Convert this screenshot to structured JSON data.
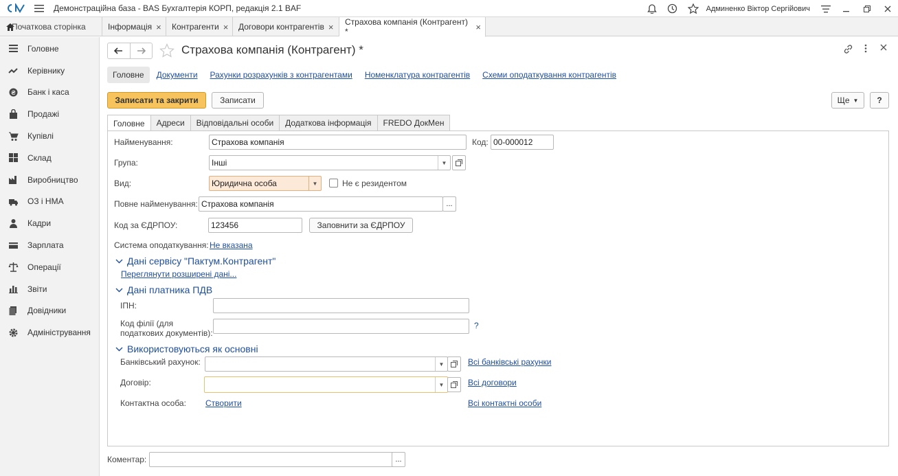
{
  "app": {
    "title": "Демонстраційна база - BAS Бухгалтерія КОРП, редакція 2.1 BAF",
    "user": "Админенко Віктор Сергійович"
  },
  "tabs": {
    "home": "Початкова сторінка",
    "items": [
      {
        "label": "Інформація"
      },
      {
        "label": "Контрагенти"
      },
      {
        "label": "Договори контрагентів"
      },
      {
        "label": "Страхова компанія (Контрагент) *"
      }
    ]
  },
  "sidebar": {
    "items": [
      {
        "label": "Головне",
        "icon": "menu-lines-icon"
      },
      {
        "label": "Керівнику",
        "icon": "trend-icon"
      },
      {
        "label": "Банк і каса",
        "icon": "coin-icon"
      },
      {
        "label": "Продажі",
        "icon": "bag-icon"
      },
      {
        "label": "Купівлі",
        "icon": "cart-icon"
      },
      {
        "label": "Склад",
        "icon": "grid-icon"
      },
      {
        "label": "Виробництво",
        "icon": "factory-icon"
      },
      {
        "label": "ОЗ і НМА",
        "icon": "truck-icon"
      },
      {
        "label": "Кадри",
        "icon": "person-icon"
      },
      {
        "label": "Зарплата",
        "icon": "card-icon"
      },
      {
        "label": "Операції",
        "icon": "scale-icon"
      },
      {
        "label": "Звіти",
        "icon": "bar-chart-icon"
      },
      {
        "label": "Довідники",
        "icon": "books-icon"
      },
      {
        "label": "Адміністрування",
        "icon": "gear-icon"
      }
    ]
  },
  "form": {
    "title": "Страхова компанія (Контрагент) *",
    "nav_links": {
      "main": "Головне",
      "documents": "Документи",
      "accounts": "Рахунки розрахунків з контрагентами",
      "nomenclature": "Номенклатура контрагентів",
      "tax_schemes": "Схеми оподаткування контрагентів"
    },
    "buttons": {
      "save_close": "Записати та закрити",
      "save": "Записати",
      "more": "Ще",
      "help": "?"
    },
    "tabs": [
      "Головне",
      "Адреси",
      "Відповідальні особи",
      "Додаткова інформація",
      "FREDO ДокМен"
    ],
    "fields": {
      "name_label": "Найменування:",
      "name_value": "Страхова компанія",
      "code_label": "Код:",
      "code_value": "00-000012",
      "group_label": "Група:",
      "group_value": "Інші",
      "kind_label": "Вид:",
      "kind_value": "Юридична особа",
      "nonresident_label": "Не є резидентом",
      "full_name_label": "Повне найменування:",
      "full_name_value": "Страхова компанія",
      "edrpou_label": "Код за ЄДРПОУ:",
      "edrpou_value": "123456",
      "fill_edrpou": "Заповнити за ЄДРПОУ",
      "tax_system_label": "Система оподаткування:",
      "tax_system_value": "Не вказана"
    },
    "sections": {
      "paktum_title": "Дані сервісу \"Пактум.Контрагент\"",
      "paktum_link": "Переглянути розширені дані...",
      "vat_title": "Дані платника ПДВ",
      "ipn_label": "ІПН:",
      "branch_label_1": "Код філії (для",
      "branch_label_2": "податкових документів):",
      "branch_help": "?",
      "defaults_title": "Використовуються як основні",
      "bank_label": "Банківський рахунок:",
      "all_banks": "Всі банківські рахунки",
      "contract_label": "Договір:",
      "all_contracts": "Всі договори",
      "contact_label": "Контактна особа:",
      "create": "Створити",
      "all_contacts": "Всі контактні особи"
    },
    "comment_label": "Коментар:",
    "ellipsis": "..."
  }
}
